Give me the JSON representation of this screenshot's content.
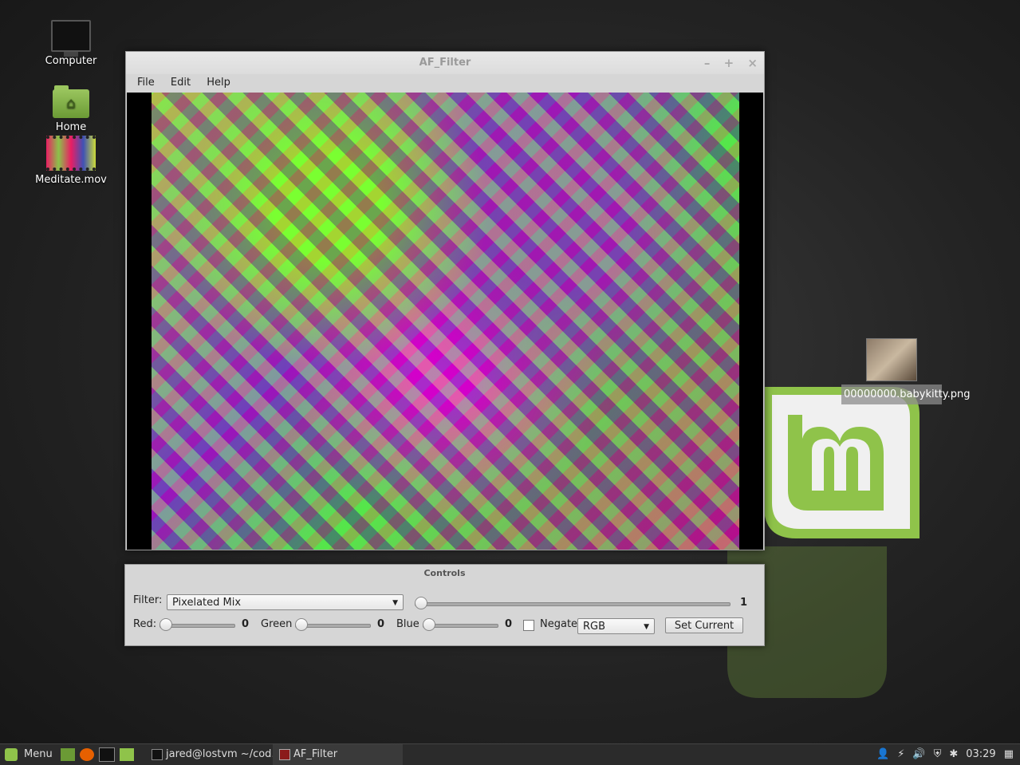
{
  "desktop": {
    "icons": [
      {
        "label": "Computer",
        "icon": "computer-icon"
      },
      {
        "label": "Home",
        "icon": "home-folder-icon"
      },
      {
        "label": "Meditate.mov",
        "icon": "video-file-icon"
      }
    ],
    "dragged_file": {
      "label": "00000000.babykitty.png"
    }
  },
  "window": {
    "title": "AF_Filter",
    "menu": {
      "file": "File",
      "edit": "Edit",
      "help": "Help"
    },
    "controls_btn": {
      "min": "–",
      "max": "+",
      "close": "×"
    }
  },
  "controls": {
    "title": "Controls",
    "filter_label": "Filter:",
    "filter_value": "Pixelated Mix",
    "filter_slider_value": "1",
    "red_label": "Red:",
    "red_value": "0",
    "green_label": "Green",
    "green_value": "0",
    "blue_label": "Blue",
    "blue_value": "0",
    "negate_label": "Negate",
    "negate_checked": false,
    "mode_value": "RGB",
    "set_current_label": "Set Current"
  },
  "taskbar": {
    "menu_label": "Menu",
    "tasks": [
      {
        "label": "jared@lostvm ~/cod..."
      },
      {
        "label": "AF_Filter"
      }
    ],
    "clock": "03:29"
  },
  "colors": {
    "mint_green": "#8fc34a",
    "taskbar_bg": "#2b2b2b",
    "window_bg": "#d6d6d6"
  }
}
